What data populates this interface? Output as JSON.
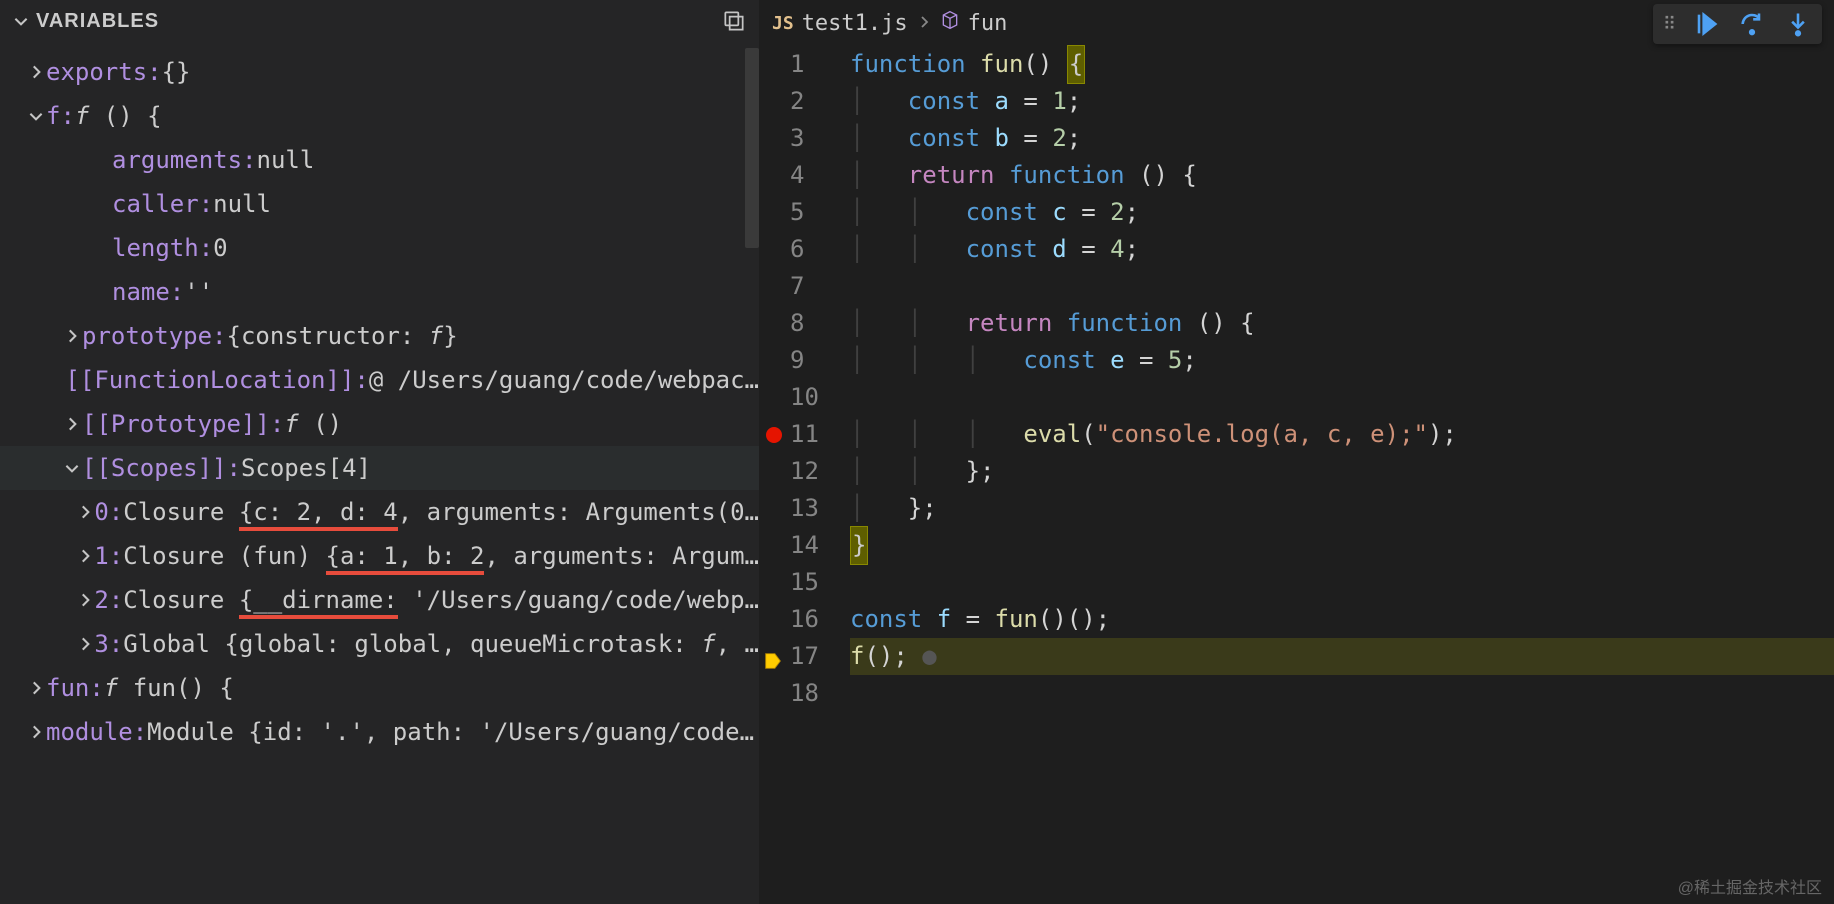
{
  "variables": {
    "title": "VARIABLES",
    "rows": [
      {
        "ind": 1,
        "chev": "right",
        "key": "exports:",
        "val": " {}"
      },
      {
        "ind": 1,
        "chev": "down",
        "key": "f:",
        "val": " f () {",
        "italicVal": true
      },
      {
        "ind": 3,
        "chev": "none",
        "key": "arguments:",
        "val": " null"
      },
      {
        "ind": 3,
        "chev": "none",
        "key": "caller:",
        "val": " null"
      },
      {
        "ind": 3,
        "chev": "none",
        "key": "length:",
        "val": " 0"
      },
      {
        "ind": 3,
        "chev": "none",
        "key": "name:",
        "val": " ''"
      },
      {
        "ind": 2,
        "chev": "right",
        "key": "prototype:",
        "val": " {constructor: f}",
        "italicF": true
      },
      {
        "ind": 3,
        "chev": "none",
        "key": "[[FunctionLocation]]:",
        "val": " @ /Users/guang/code/webpac…"
      },
      {
        "ind": 2,
        "chev": "right",
        "key": "[[Prototype]]:",
        "val": " f ()",
        "italicVal": true
      },
      {
        "ind": 2,
        "chev": "down",
        "key": "[[Scopes]]:",
        "val": " Scopes[4]",
        "selected": true
      },
      {
        "ind": 4,
        "chev": "right",
        "key": "0:",
        "val": " Closure ",
        "u1": "{c: 2, d: 4",
        "tail": ", arguments: Arguments(0…"
      },
      {
        "ind": 4,
        "chev": "right",
        "key": "1:",
        "val": " Closure (fun) ",
        "u1": "{a: 1, b: 2",
        "tail": ", arguments: Argum…"
      },
      {
        "ind": 4,
        "chev": "right",
        "key": "2:",
        "val": " Closure ",
        "u1": "{__dirname:",
        "tail": " '/Users/guang/code/webp…"
      },
      {
        "ind": 4,
        "chev": "right",
        "key": "3:",
        "val": " Global {global: global, queueMicrotask: f, …",
        "italicF": true
      },
      {
        "ind": 1,
        "chev": "right",
        "key": "fun:",
        "val": " f fun() {",
        "italicVal": true
      },
      {
        "ind": 1,
        "chev": "right",
        "key": "module:",
        "val": " Module {id: '.', path: '/Users/guang/code…"
      }
    ]
  },
  "breadcrumb": {
    "file": "test1.js",
    "symbol": "fun"
  },
  "code": {
    "lines": [
      {
        "n": 1,
        "bp": "",
        "seg": [
          [
            "tk-blue",
            "function "
          ],
          [
            "tk-fn",
            "fun"
          ],
          [
            "tk-plain",
            "() "
          ],
          [
            "hl-brace",
            "{"
          ]
        ]
      },
      {
        "n": 2,
        "bp": "",
        "pre": "    ",
        "seg": [
          [
            "tk-blue",
            "const "
          ],
          [
            "tk-const",
            "a"
          ],
          [
            "tk-plain",
            " = "
          ],
          [
            "tk-num",
            "1"
          ],
          [
            "tk-plain",
            ";"
          ]
        ]
      },
      {
        "n": 3,
        "bp": "",
        "pre": "    ",
        "seg": [
          [
            "tk-blue",
            "const "
          ],
          [
            "tk-const",
            "b"
          ],
          [
            "tk-plain",
            " = "
          ],
          [
            "tk-num",
            "2"
          ],
          [
            "tk-plain",
            ";"
          ]
        ]
      },
      {
        "n": 4,
        "bp": "",
        "pre": "    ",
        "seg": [
          [
            "tk-kw",
            "return "
          ],
          [
            "tk-blue",
            "function "
          ],
          [
            "tk-plain",
            "() {"
          ]
        ]
      },
      {
        "n": 5,
        "bp": "",
        "pre": "        ",
        "seg": [
          [
            "tk-blue",
            "const "
          ],
          [
            "tk-const",
            "c"
          ],
          [
            "tk-plain",
            " = "
          ],
          [
            "tk-num",
            "2"
          ],
          [
            "tk-plain",
            ";"
          ]
        ]
      },
      {
        "n": 6,
        "bp": "",
        "pre": "        ",
        "seg": [
          [
            "tk-blue",
            "const "
          ],
          [
            "tk-const",
            "d"
          ],
          [
            "tk-plain",
            " = "
          ],
          [
            "tk-num",
            "4"
          ],
          [
            "tk-plain",
            ";"
          ]
        ]
      },
      {
        "n": 7,
        "bp": "",
        "pre": "",
        "seg": []
      },
      {
        "n": 8,
        "bp": "",
        "pre": "        ",
        "seg": [
          [
            "tk-kw",
            "return "
          ],
          [
            "tk-blue",
            "function "
          ],
          [
            "tk-plain",
            "() {"
          ]
        ]
      },
      {
        "n": 9,
        "bp": "",
        "pre": "            ",
        "seg": [
          [
            "tk-blue",
            "const "
          ],
          [
            "tk-const",
            "e"
          ],
          [
            "tk-plain",
            " = "
          ],
          [
            "tk-num",
            "5"
          ],
          [
            "tk-plain",
            ";"
          ]
        ]
      },
      {
        "n": 10,
        "bp": "",
        "pre": "",
        "seg": []
      },
      {
        "n": 11,
        "bp": "red",
        "pre": "            ",
        "seg": [
          [
            "tk-fn",
            "eval"
          ],
          [
            "tk-plain",
            "("
          ],
          [
            "tk-str",
            "\"console.log(a, c, e);\""
          ],
          [
            "tk-plain",
            ");"
          ]
        ]
      },
      {
        "n": 12,
        "bp": "",
        "pre": "        ",
        "seg": [
          [
            "tk-plain",
            "};"
          ]
        ]
      },
      {
        "n": 13,
        "bp": "",
        "pre": "    ",
        "seg": [
          [
            "tk-plain",
            "};"
          ]
        ]
      },
      {
        "n": 14,
        "bp": "",
        "seg": [
          [
            "hl-brace",
            "}"
          ]
        ]
      },
      {
        "n": 15,
        "bp": "",
        "seg": []
      },
      {
        "n": 16,
        "bp": "",
        "seg": [
          [
            "tk-blue",
            "const "
          ],
          [
            "tk-const",
            "f"
          ],
          [
            "tk-plain",
            " = "
          ],
          [
            "tk-fn",
            "fun"
          ],
          [
            "tk-plain",
            "()();"
          ]
        ]
      },
      {
        "n": 17,
        "bp": "cur",
        "hl": true,
        "seg": [
          [
            "tk-fn",
            "f"
          ],
          [
            "tk-plain",
            "();"
          ],
          [
            "dim-circle",
            " ●"
          ]
        ]
      },
      {
        "n": 18,
        "bp": "",
        "seg": []
      }
    ]
  },
  "watermark": "@稀土掘金技术社区"
}
